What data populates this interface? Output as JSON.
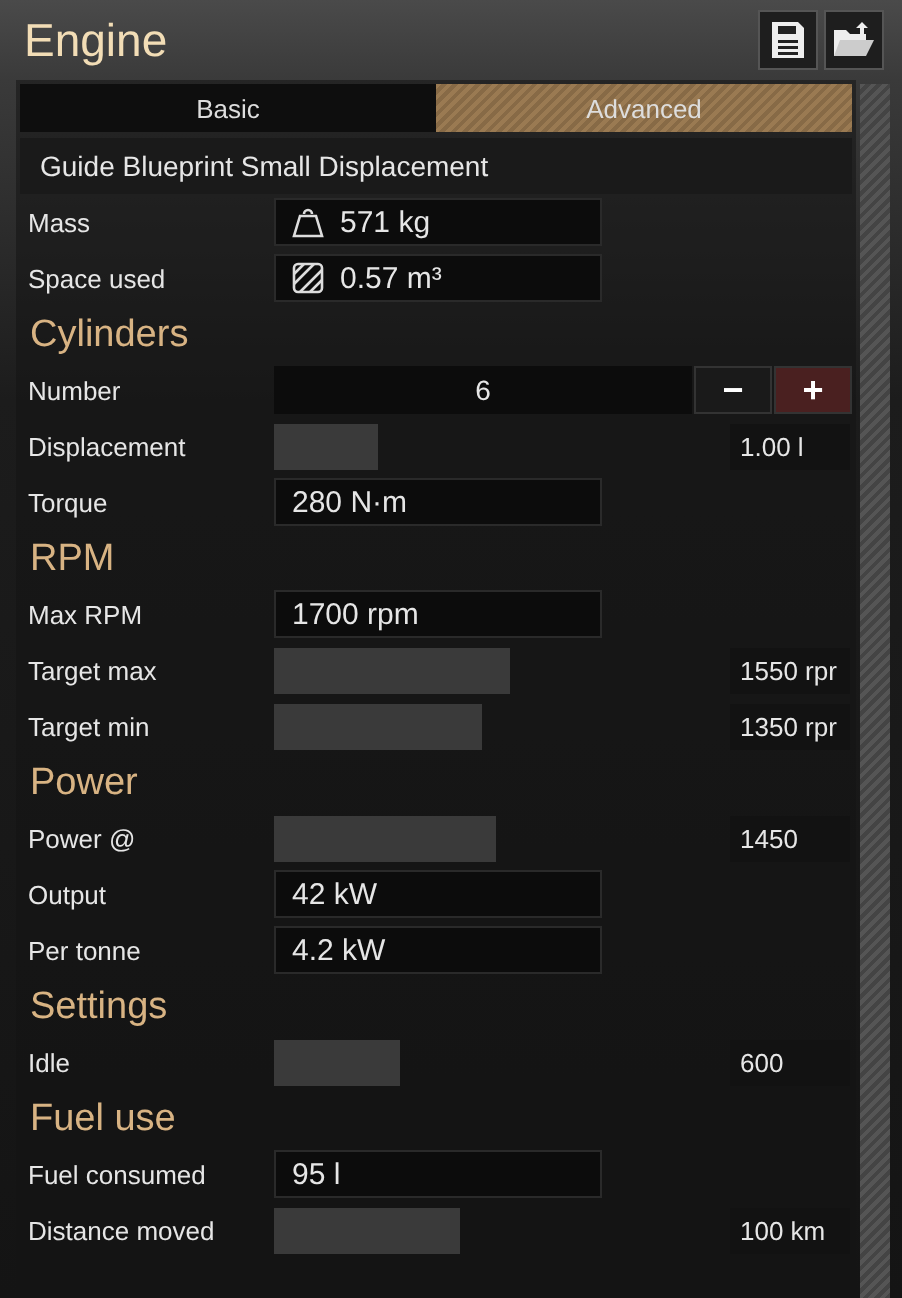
{
  "window": {
    "title": "Engine"
  },
  "toolbar": [
    {
      "kind": "save"
    },
    {
      "kind": "open"
    }
  ],
  "tabs": [
    {
      "label": "Basic",
      "selected": false
    },
    {
      "label": "Advanced",
      "selected": true
    }
  ],
  "blueprint": "Guide Blueprint Small Displacement",
  "sections": [
    {
      "rows": [
        {
          "kind": "mass",
          "label": "Mass",
          "value": "571 kg"
        },
        {
          "kind": "space",
          "label": "Space used",
          "value": "0.57 m³"
        }
      ]
    },
    {
      "heading": "Cylinders",
      "rows": [
        {
          "kind": "stepper",
          "label": "Number",
          "value": "6",
          "buttons": [
            {
              "label": "−",
              "highlighted": false
            },
            {
              "label": "+",
              "highlighted": true
            }
          ]
        },
        {
          "kind": "slider",
          "label": "Displacement",
          "level": 0.23,
          "value": "1.00 l"
        },
        {
          "kind": "readout",
          "label": "Torque",
          "value": "280 N·m"
        }
      ]
    },
    {
      "heading": "RPM",
      "rows": [
        {
          "kind": "readout",
          "label": "Max RPM",
          "value": "1700 rpm"
        },
        {
          "kind": "slider",
          "label": "Target max",
          "level": 0.52,
          "value": "1550 rpr"
        },
        {
          "kind": "slider",
          "label": "Target min",
          "level": 0.46,
          "value": "1350 rpr"
        }
      ]
    },
    {
      "heading": "Power",
      "rows": [
        {
          "kind": "slider",
          "label": "Power @",
          "level": 0.49,
          "value": "1450"
        },
        {
          "kind": "readout",
          "label": "Output",
          "value": "42 kW"
        },
        {
          "kind": "readout",
          "label": "Per tonne",
          "value": "4.2 kW"
        }
      ]
    },
    {
      "heading": "Settings",
      "rows": [
        {
          "kind": "slider",
          "label": "Idle",
          "level": 0.28,
          "value": "600"
        }
      ]
    },
    {
      "heading": "Fuel use",
      "rows": [
        {
          "kind": "readout",
          "label": "Fuel consumed",
          "value": "95 l"
        },
        {
          "kind": "slider",
          "label": "Distance moved",
          "level": 0.41,
          "value": "100 km"
        }
      ]
    }
  ]
}
